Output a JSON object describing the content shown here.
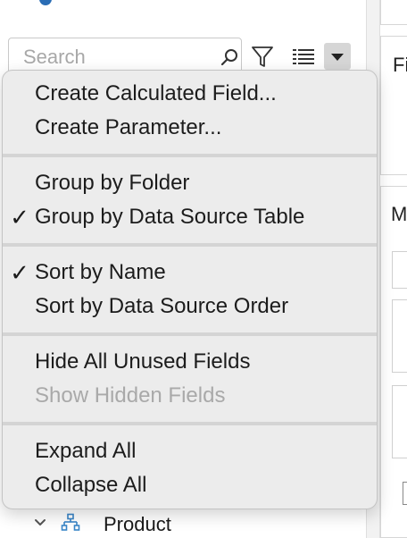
{
  "search": {
    "placeholder": "Search"
  },
  "right_pane": {
    "fi_label": "Fi",
    "m_label": "M"
  },
  "tree": {
    "product_label": "Product"
  },
  "menu": {
    "groups": [
      {
        "items": [
          {
            "label": "Create Calculated Field...",
            "checked": false,
            "enabled": true
          },
          {
            "label": "Create Parameter...",
            "checked": false,
            "enabled": true
          }
        ]
      },
      {
        "items": [
          {
            "label": "Group by Folder",
            "checked": false,
            "enabled": true
          },
          {
            "label": "Group by Data Source Table",
            "checked": true,
            "enabled": true
          }
        ]
      },
      {
        "items": [
          {
            "label": "Sort by Name",
            "checked": true,
            "enabled": true
          },
          {
            "label": "Sort by Data Source Order",
            "checked": false,
            "enabled": true
          }
        ]
      },
      {
        "items": [
          {
            "label": "Hide All Unused Fields",
            "checked": false,
            "enabled": true
          },
          {
            "label": "Show Hidden Fields",
            "checked": false,
            "enabled": false
          }
        ]
      },
      {
        "items": [
          {
            "label": "Expand All",
            "checked": false,
            "enabled": true
          },
          {
            "label": "Collapse All",
            "checked": false,
            "enabled": true
          }
        ]
      }
    ],
    "check_glyph": "✓"
  },
  "colors": {
    "hierarchy_icon": "#3a86c8",
    "accent": "#2a6db5"
  }
}
